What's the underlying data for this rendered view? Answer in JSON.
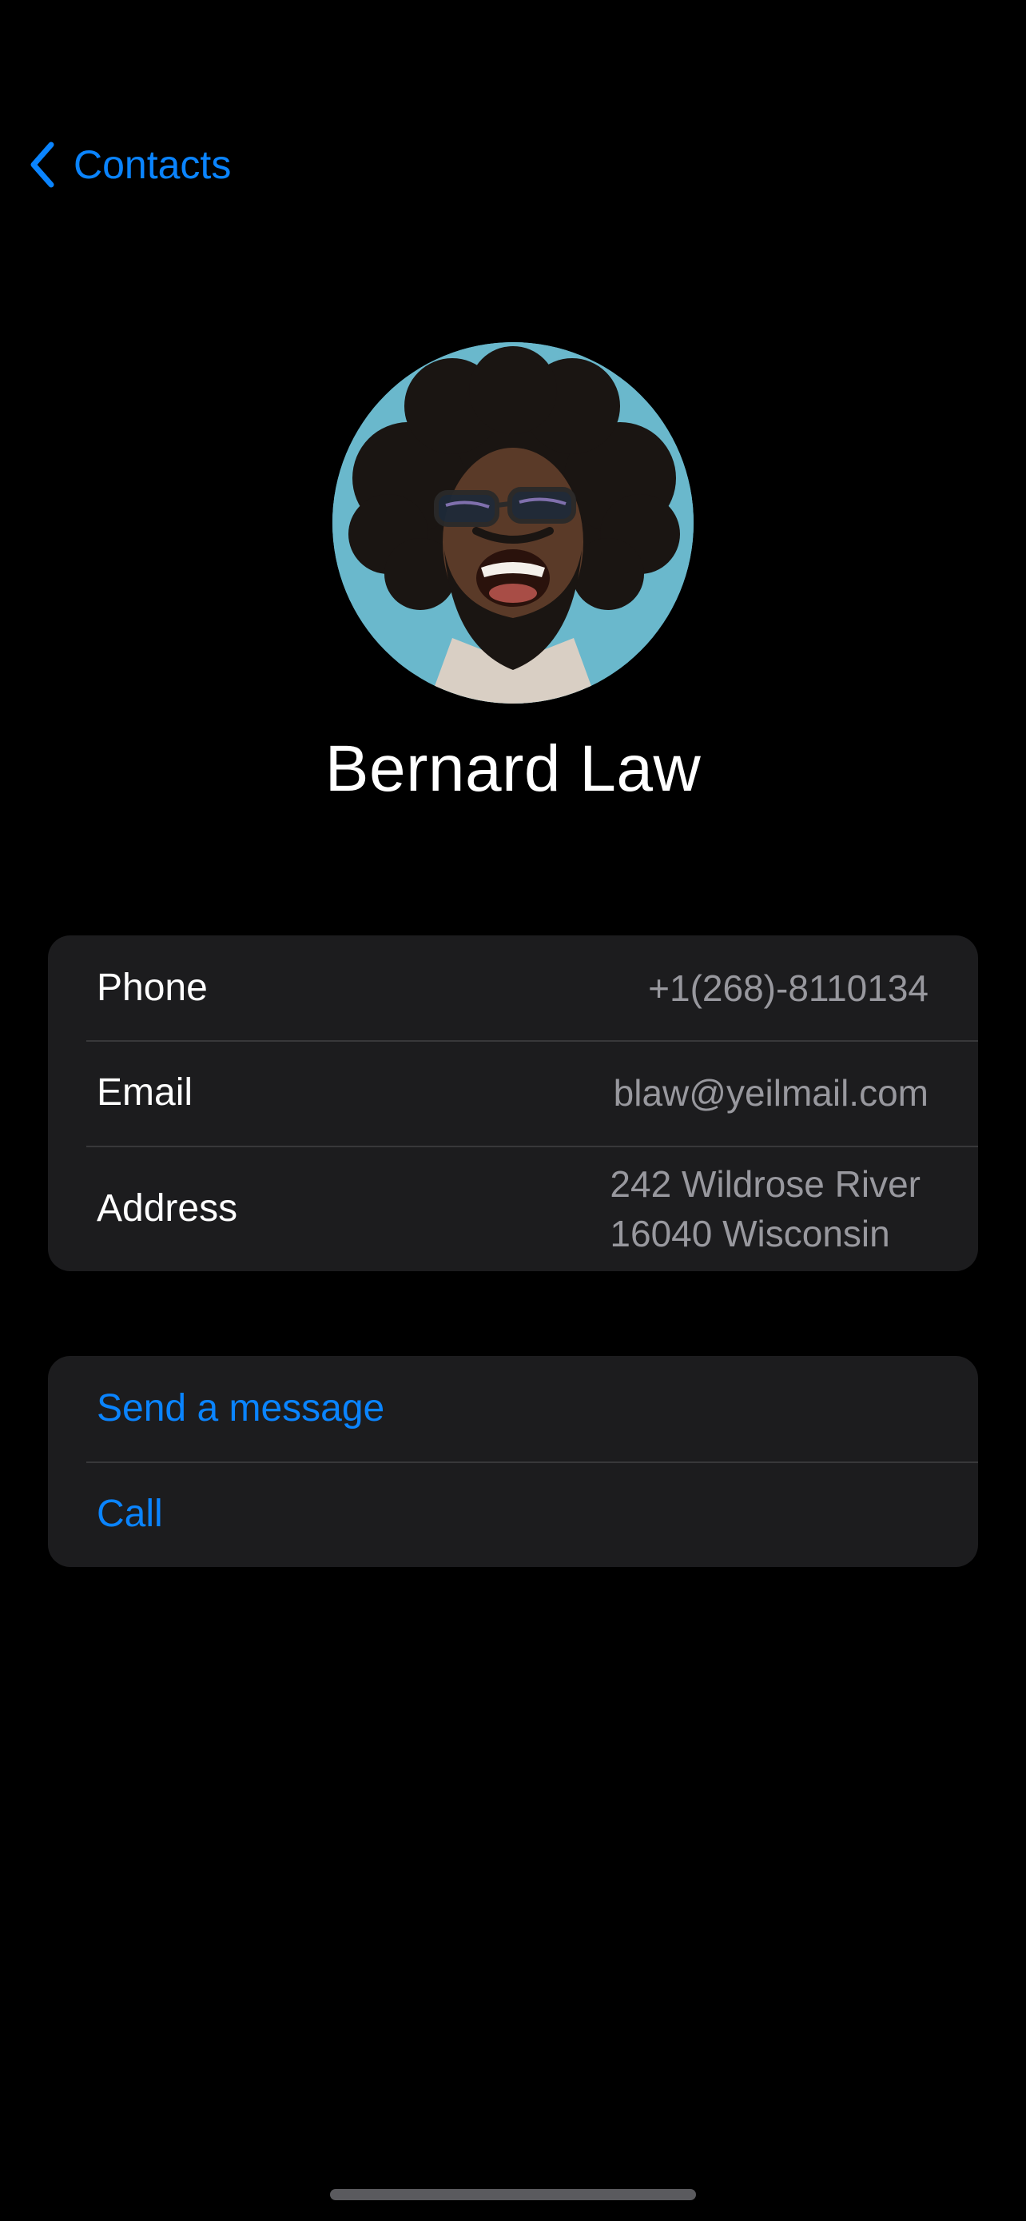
{
  "nav": {
    "back_label": "Contacts"
  },
  "contact": {
    "name": "Bernard Law"
  },
  "details": {
    "phone": {
      "label": "Phone",
      "value": "+1(268)-8110134"
    },
    "email": {
      "label": "Email",
      "value": "blaw@yeilmail.com"
    },
    "address": {
      "label": "Address",
      "line1": "242 Wildrose River",
      "line2": "16040 Wisconsin"
    }
  },
  "actions": {
    "message_label": "Send a message",
    "call_label": "Call"
  },
  "colors": {
    "accent": "#0a84ff",
    "background": "#000000",
    "card": "#1c1c1e",
    "secondary_text": "#98989e"
  }
}
